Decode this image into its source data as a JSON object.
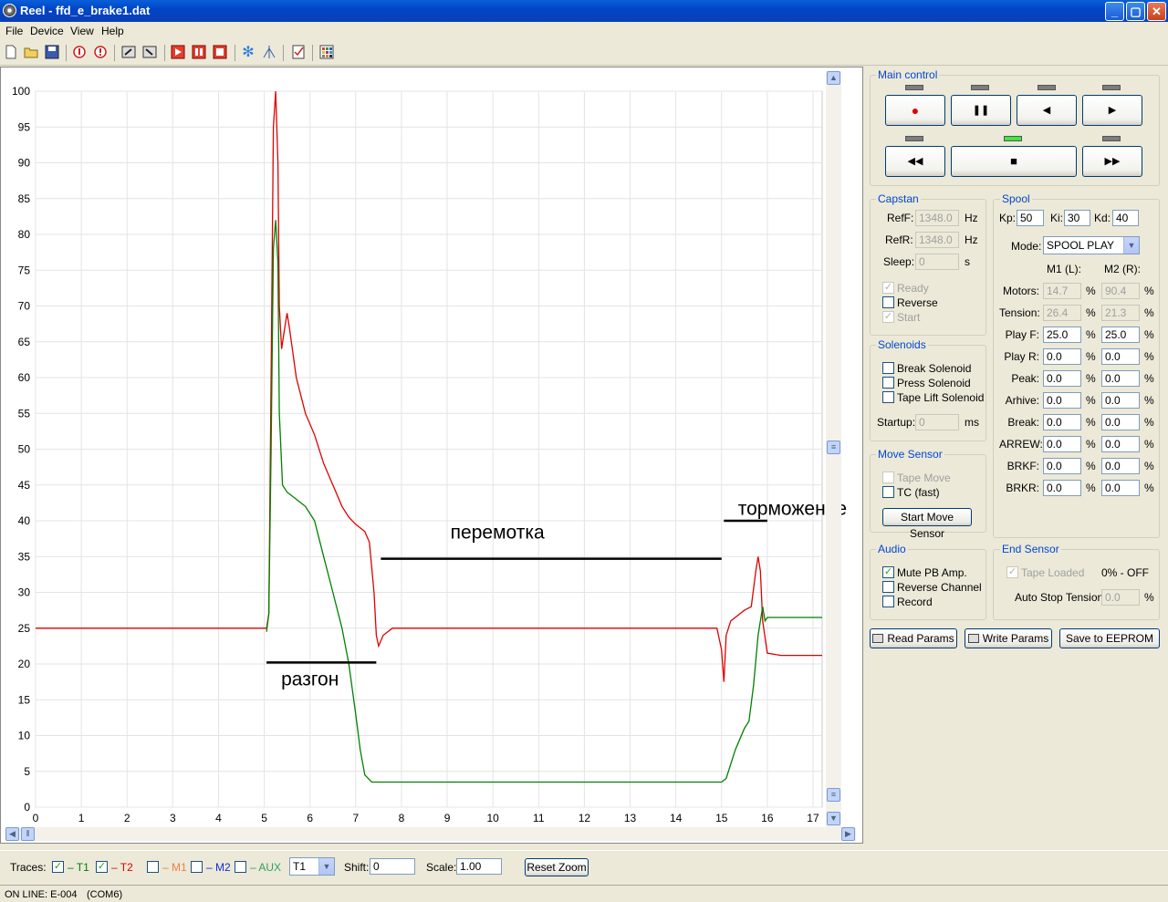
{
  "window": {
    "title": "Reel - ffd_e_brake1.dat",
    "min": "_",
    "max": "▢",
    "close": "✕"
  },
  "menu": [
    "File",
    "Device",
    "View",
    "Help"
  ],
  "toolbar_icons": [
    "new-file-icon",
    "open-folder-icon",
    "save-icon",
    "stop-circle-icon",
    "info-circle-icon",
    "export-icon",
    "import-icon",
    "record-icon",
    "pause-icon",
    "stop-icon",
    "snowflake-icon",
    "tree-icon",
    "checklist-icon",
    "grid-icon"
  ],
  "chart": {
    "x_ticks": [
      "0",
      "1",
      "2",
      "3",
      "4",
      "5",
      "6",
      "7",
      "8",
      "9",
      "10",
      "11",
      "12",
      "13",
      "14",
      "15",
      "16",
      "17"
    ],
    "y_ticks": [
      "0",
      "5",
      "10",
      "15",
      "20",
      "25",
      "30",
      "35",
      "40",
      "45",
      "50",
      "55",
      "60",
      "65",
      "70",
      "75",
      "80",
      "85",
      "90",
      "95",
      "100"
    ],
    "xlim": [
      0,
      17.2
    ],
    "ylim": [
      0,
      100
    ],
    "annotations": {
      "razgon": "разгон",
      "peremotka": "перемотка",
      "tormozhenie": "торможение"
    },
    "colors": {
      "t1": "#e00000",
      "t2": "#008000"
    }
  },
  "chart_data": {
    "type": "line",
    "xlim": [
      0,
      17.2
    ],
    "ylim": [
      0,
      100
    ],
    "grid": true,
    "series": [
      {
        "name": "T1",
        "color": "#e00000",
        "points": [
          [
            0,
            25
          ],
          [
            5.05,
            25
          ],
          [
            5.1,
            27
          ],
          [
            5.15,
            60
          ],
          [
            5.2,
            95
          ],
          [
            5.25,
            100
          ],
          [
            5.3,
            90
          ],
          [
            5.33,
            70
          ],
          [
            5.38,
            64
          ],
          [
            5.45,
            67
          ],
          [
            5.5,
            69
          ],
          [
            5.55,
            67
          ],
          [
            5.7,
            60
          ],
          [
            5.9,
            55
          ],
          [
            6.1,
            52
          ],
          [
            6.3,
            48
          ],
          [
            6.5,
            45
          ],
          [
            6.7,
            42
          ],
          [
            6.85,
            40.5
          ],
          [
            7.0,
            39.5
          ],
          [
            7.2,
            38.5
          ],
          [
            7.3,
            37
          ],
          [
            7.4,
            30
          ],
          [
            7.45,
            24
          ],
          [
            7.5,
            22.5
          ],
          [
            7.6,
            24
          ],
          [
            7.8,
            25
          ],
          [
            10,
            25
          ],
          [
            13,
            25
          ],
          [
            14.9,
            25
          ],
          [
            15.0,
            22
          ],
          [
            15.05,
            17.5
          ],
          [
            15.1,
            24
          ],
          [
            15.2,
            26
          ],
          [
            15.5,
            27.5
          ],
          [
            15.65,
            28
          ],
          [
            15.75,
            33
          ],
          [
            15.8,
            35
          ],
          [
            15.85,
            33
          ],
          [
            15.9,
            26
          ],
          [
            16.0,
            21.5
          ],
          [
            16.3,
            21.2
          ],
          [
            17.2,
            21.2
          ]
        ]
      },
      {
        "name": "T2",
        "color": "#008000",
        "points": [
          [
            5.05,
            24.5
          ],
          [
            5.1,
            27
          ],
          [
            5.15,
            50
          ],
          [
            5.2,
            78
          ],
          [
            5.25,
            82
          ],
          [
            5.3,
            76
          ],
          [
            5.33,
            55
          ],
          [
            5.4,
            45
          ],
          [
            5.5,
            44
          ],
          [
            5.7,
            43
          ],
          [
            5.9,
            42
          ],
          [
            6.1,
            40
          ],
          [
            6.3,
            35
          ],
          [
            6.5,
            30
          ],
          [
            6.7,
            25
          ],
          [
            6.85,
            20
          ],
          [
            7.0,
            13
          ],
          [
            7.1,
            8
          ],
          [
            7.2,
            4.5
          ],
          [
            7.35,
            3.5
          ],
          [
            10,
            3.5
          ],
          [
            13,
            3.5
          ],
          [
            15.0,
            3.5
          ],
          [
            15.1,
            4
          ],
          [
            15.3,
            8
          ],
          [
            15.5,
            11
          ],
          [
            15.6,
            12
          ],
          [
            15.7,
            17
          ],
          [
            15.8,
            24
          ],
          [
            15.9,
            28
          ],
          [
            15.95,
            26
          ],
          [
            16.0,
            26.5
          ],
          [
            17.2,
            26.5
          ]
        ]
      }
    ],
    "x_ticks": [
      "0",
      "1",
      "2",
      "3",
      "4",
      "5",
      "6",
      "7",
      "8",
      "9",
      "10",
      "11",
      "12",
      "13",
      "14",
      "15",
      "16",
      "17"
    ],
    "annotations": [
      "разгон",
      "перемотка",
      "торможение"
    ]
  },
  "main_control": {
    "title": "Main control",
    "buttons_row1": [
      "●",
      "❚❚",
      "◀",
      "▶"
    ],
    "buttons_row2": [
      "◀◀",
      "■",
      "▶▶"
    ]
  },
  "capstan": {
    "title": "Capstan",
    "reff_label": "RefF:",
    "reff_value": "1348.0",
    "reff_unit": "Hz",
    "refr_label": "RefR:",
    "refr_value": "1348.0",
    "refr_unit": "Hz",
    "sleep_label": "Sleep:",
    "sleep_value": "0",
    "sleep_unit": "s",
    "ready": "Ready",
    "reverse": "Reverse",
    "start": "Start"
  },
  "solenoids": {
    "title": "Solenoids",
    "break": "Break Solenoid",
    "press": "Press Solenoid",
    "tape_lift": "Tape Lift Solenoid",
    "startup_label": "Startup:",
    "startup_value": "0",
    "startup_unit": "ms"
  },
  "move_sensor": {
    "title": "Move Sensor",
    "tape_move": "Tape Move",
    "tc_fast": "TC (fast)",
    "start_button": "Start Move Sensor"
  },
  "audio": {
    "title": "Audio",
    "mute": "Mute PB Amp.",
    "reverse": "Reverse Channel",
    "record": "Record"
  },
  "spool": {
    "title": "Spool",
    "kp_label": "Kp:",
    "kp": "50",
    "ki_label": "Ki:",
    "ki": "30",
    "kd_label": "Kd:",
    "kd": "40",
    "mode_label": "Mode:",
    "mode": "SPOOL PLAY",
    "m1_header": "M1 (L):",
    "m2_header": "M2 (R):",
    "rows": [
      {
        "label": "Motors:",
        "m1": "14.7",
        "m2": "90.4",
        "unit": "%",
        "disabled": true
      },
      {
        "label": "Tension:",
        "m1": "26.4",
        "m2": "21.3",
        "unit": "%",
        "disabled": true
      },
      {
        "label": "Play F:",
        "m1": "25.0",
        "m2": "25.0",
        "unit": "%",
        "disabled": false
      },
      {
        "label": "Play R:",
        "m1": "0.0",
        "m2": "0.0",
        "unit": "%",
        "disabled": false
      },
      {
        "label": "Peak:",
        "m1": "0.0",
        "m2": "0.0",
        "unit": "%",
        "disabled": false
      },
      {
        "label": "Arhive:",
        "m1": "0.0",
        "m2": "0.0",
        "unit": "%",
        "disabled": false
      },
      {
        "label": "Break:",
        "m1": "0.0",
        "m2": "0.0",
        "unit": "%",
        "disabled": false
      },
      {
        "label": "ARREW:",
        "m1": "0.0",
        "m2": "0.0",
        "unit": "%",
        "disabled": false
      },
      {
        "label": "BRKF:",
        "m1": "0.0",
        "m2": "0.0",
        "unit": "%",
        "disabled": false
      },
      {
        "label": "BRKR:",
        "m1": "0.0",
        "m2": "0.0",
        "unit": "%",
        "disabled": false
      }
    ]
  },
  "end_sensor": {
    "title": "End Sensor",
    "tape_loaded": "Tape Loaded",
    "status": "0% - OFF",
    "auto_stop_label": "Auto Stop Tension:",
    "auto_stop_value": "0.0",
    "auto_stop_unit": "%"
  },
  "params": {
    "read": "Read Params",
    "write": "Write Params",
    "save": "Save to EEPROM"
  },
  "traces": {
    "label": "Traces:",
    "t1": "– T1",
    "t2": "– T2",
    "m1": "– M1",
    "m2": "– M2",
    "aux": "– AUX",
    "select": "T1",
    "shift_label": "Shift:",
    "shift": "0",
    "scale_label": "Scale:",
    "scale": "1.00",
    "reset": "Reset Zoom"
  },
  "status": {
    "online": "ON LINE: E-004",
    "port": "(COM6)"
  }
}
